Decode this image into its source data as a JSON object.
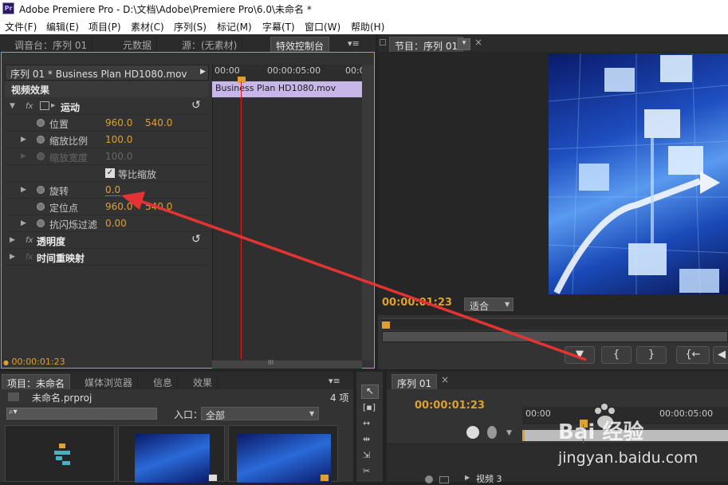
{
  "window": {
    "app_icon": "Pr",
    "title": "Adobe Premiere Pro - D:\\文档\\Adobe\\Premiere Pro\\6.0\\未命名 *"
  },
  "menu": [
    "文件(F)",
    "编辑(E)",
    "项目(P)",
    "素材(C)",
    "序列(S)",
    "标记(M)",
    "字幕(T)",
    "窗口(W)",
    "帮助(H)"
  ],
  "top_tabs": {
    "mixer": "调音台：序列 01",
    "metadata": "元数据",
    "source": "源：(无素材)",
    "effect_controls": "特效控制台",
    "menu_glyph": "▾≡",
    "program": "节目：序列 01",
    "program_dropdown": "▾",
    "close": "×"
  },
  "effect_controls": {
    "clip_path": "序列 01 * Business Plan HD1080.mov",
    "section": "视频效果",
    "motion": "运动",
    "position_label": "位置",
    "position_x": "960.0",
    "position_y": "540.0",
    "scale_label": "缩放比例",
    "scale_value": "100.0",
    "scale_width_label": "缩放宽度",
    "scale_width_value": "100.0",
    "uniform_label": "等比缩放",
    "rotation_label": "旋转",
    "rotation_value": "0.0",
    "anchor_label": "定位点",
    "anchor_x": "960.0",
    "anchor_y": "540.0",
    "flicker_label": "抗闪烁过滤",
    "flicker_value": "0.00",
    "opacity_label": "透明度",
    "timeremap_label": "时间重映射",
    "fx": "fx",
    "time_start": "00:00",
    "time_mid": "00:00:05:00",
    "time_end": "00:0",
    "clip_bar": "Business Plan HD1080.mov",
    "current_time": "00:00:01:23",
    "grip": "III"
  },
  "program": {
    "timecode": "00:00:01:23",
    "fit": "适合",
    "fit_arrow": "▼",
    "transport": [
      "▼",
      "{",
      "}",
      "{←",
      "◀"
    ]
  },
  "project": {
    "tabs": [
      "项目：未命名",
      "媒体浏览器",
      "信息",
      "效果"
    ],
    "filename": "未命名.prproj",
    "count": "4 项",
    "search_placeholder": "",
    "search_glyph": "⌕▾",
    "entry_label": "入口：",
    "entry_value": "全部",
    "entry_arrow": "▼"
  },
  "sequence": {
    "tab": "序列 01",
    "timecode": "00:00:01:23",
    "time_start": "00:00",
    "time_mid": "00:00:05:00",
    "track": "视频 3"
  },
  "watermark": {
    "logo": "Bai  经验",
    "url": "jingyan.baidu.com"
  },
  "colors": {
    "accent_orange": "#e0a02c",
    "clip_purple": "#c6b7e8",
    "playhead_red": "#e02020",
    "annotation_red": "#e33333"
  }
}
